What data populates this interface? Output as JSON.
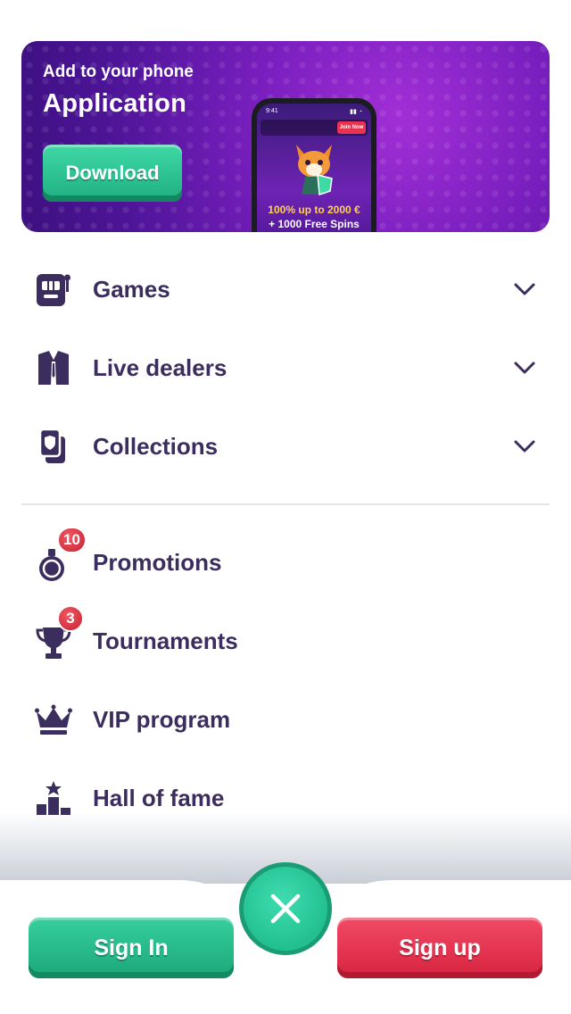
{
  "banner": {
    "subtitle": "Add to your phone",
    "title": "Application",
    "download_label": "Download",
    "phone": {
      "time": "9:41",
      "join_label": "Join Now",
      "promo_line1": "100% up to 2000 €",
      "promo_line2": "+ 1000 Free Spins"
    }
  },
  "menu": {
    "primary": [
      {
        "label": "Games",
        "icon": "slot-machine-icon"
      },
      {
        "label": "Live dealers",
        "icon": "dealer-suit-icon"
      },
      {
        "label": "Collections",
        "icon": "cards-icon"
      }
    ],
    "secondary": [
      {
        "label": "Promotions",
        "icon": "promotion-ring-icon",
        "badge": "10"
      },
      {
        "label": "Tournaments",
        "icon": "trophy-icon",
        "badge": "3"
      },
      {
        "label": "VIP program",
        "icon": "crown-icon"
      },
      {
        "label": "Hall of fame",
        "icon": "podium-icon"
      }
    ]
  },
  "footer": {
    "signin_label": "Sign In",
    "signup_label": "Sign up",
    "close_icon": "close-icon"
  },
  "colors": {
    "text": "#3b2d5e",
    "accent_green": "#22c08f",
    "accent_red": "#e8324f",
    "banner_purple": "#7b1fc0"
  }
}
